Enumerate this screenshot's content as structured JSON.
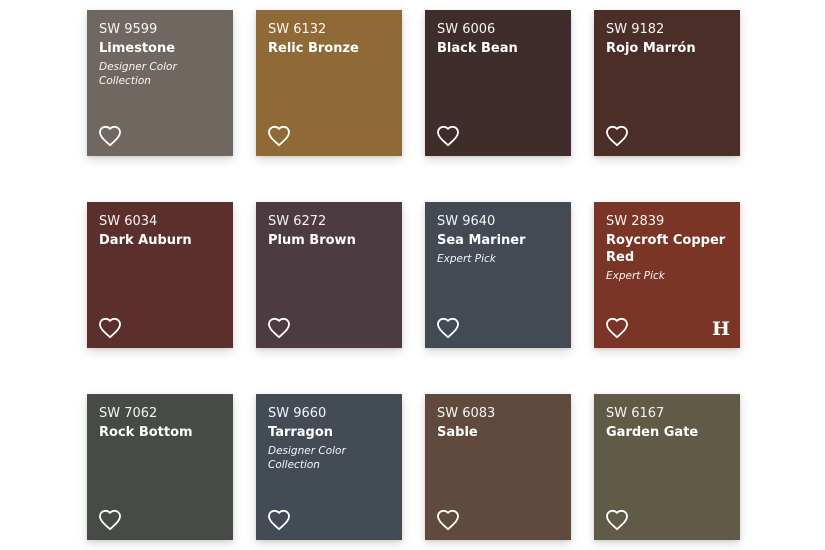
{
  "swatches": [
    {
      "code": "SW 9599",
      "name": "Limestone",
      "tag": "Designer Color Collection",
      "color": "#6e6860"
    },
    {
      "code": "SW 6132",
      "name": "Relic Bronze",
      "tag": "",
      "color": "#8f6a37"
    },
    {
      "code": "SW 6006",
      "name": "Black Bean",
      "tag": "",
      "color": "#3f2d2b"
    },
    {
      "code": "SW 9182",
      "name": "Rojo Marrón",
      "tag": "",
      "color": "#4a2e27"
    },
    {
      "code": "SW 6034",
      "name": "Dark Auburn",
      "tag": "",
      "color": "#5b302c"
    },
    {
      "code": "SW 6272",
      "name": "Plum Brown",
      "tag": "",
      "color": "#4c3b41"
    },
    {
      "code": "SW 9640",
      "name": "Sea Mariner",
      "tag": "Expert Pick",
      "color": "#434a53"
    },
    {
      "code": "SW 2839",
      "name": "Roycroft Copper Red",
      "tag": "Expert Pick",
      "color": "#7a3526",
      "brand_logo": "H"
    },
    {
      "code": "SW 7062",
      "name": "Rock Bottom",
      "tag": "",
      "color": "#474b46"
    },
    {
      "code": "SW 9660",
      "name": "Tarragon",
      "tag": "Designer Color Collection",
      "color": "#434b55"
    },
    {
      "code": "SW 6083",
      "name": "Sable",
      "tag": "",
      "color": "#5f4a3d"
    },
    {
      "code": "SW 6167",
      "name": "Garden Gate",
      "tag": "",
      "color": "#5f5b47"
    }
  ],
  "icons": {
    "favorite": "heart-outline-icon"
  }
}
